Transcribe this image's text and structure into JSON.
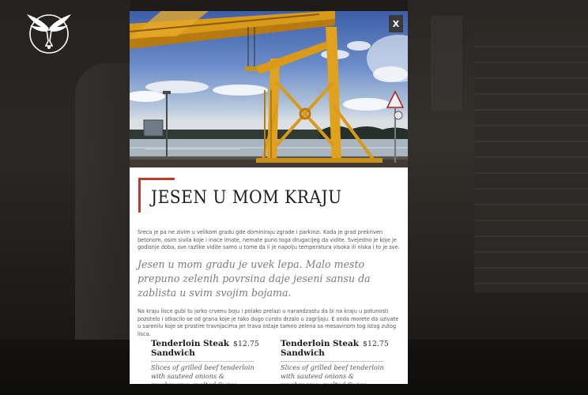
{
  "modal": {
    "close_label": "X",
    "title": "JESEN U MOM KRAJU",
    "paragraph_1": "Sreca je pa ne zivim u velikom gradu gde dominiraju zgrade i parkinzi. Kada je grad prekriven betonom, osim sivila koje i inace imate, nemate puno toga drugacijeg da vidite. Svejedno je koje je godisnje doba, sve razlike vidite samo u tome da li je napolju temperatura visoka ili niska i to je sve.",
    "quote": "Jesen u mom gradu je uvek lepa. Malo mesto prepuno zelenih povrsina daje jeseni sansu da zablista u svim svojim bojama.",
    "paragraph_2": "Na kraju lisce gubi tu jarko crvenu boju i polako prelazi u narandzastu da bi na kraju u potunosti pozutelo i otkacilo se od grana koje je tako dugo cvrsto drzalo u zagrljaju. E onda morete da uzivate u sarenilu koje se prostire travnjacima jer trava ostaje tamno zelena sa mesavinom tog istog zutog lisca.",
    "menu": [
      {
        "name": "Tenderloin Steak Sandwich",
        "price": "$12.75",
        "description": "Slices of grilled beef tenderloin with sauteed onions & mushrooms, melted Swiss, lettuce & tomato on a"
      },
      {
        "name": "Tenderloin Steak Sandwich",
        "price": "$12.75",
        "description": "Slices of grilled beef tenderloin with sauteed onions & mushrooms, melted Swiss, lettuce & tomato on a"
      }
    ]
  },
  "colors": {
    "accent": "#c0392b",
    "crane": "#e0a21c",
    "overlay_bg": "#1d1a18"
  },
  "icons": {
    "logo": "winged-emblem-icon",
    "close": "close-icon"
  }
}
